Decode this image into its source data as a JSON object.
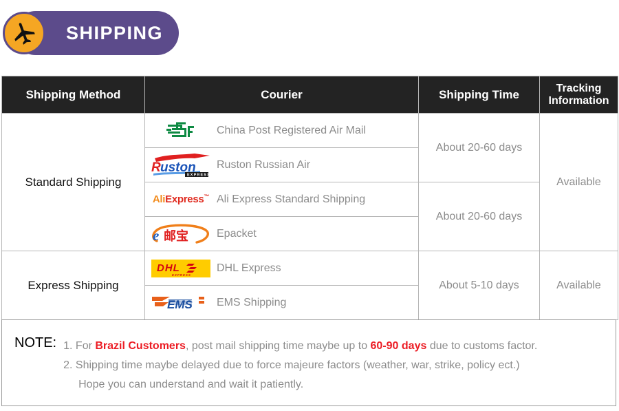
{
  "banner": {
    "title": "SHIPPING",
    "icon": "airplane-icon",
    "pill_color": "#5C4B8B",
    "badge_color": "#F5A623"
  },
  "table": {
    "headers": {
      "method": "Shipping Method",
      "courier": "Courier",
      "time": "Shipping Time",
      "tracking": "Tracking Information",
      "tracking_line1": "Tracking",
      "tracking_line2": "Information"
    },
    "groups": [
      {
        "method": "Standard Shipping",
        "tracking": "Available",
        "times": [
          {
            "label": "About 20-60 days",
            "rows": 2
          },
          {
            "label": "About 20-60 days",
            "rows": 2
          }
        ],
        "couriers": [
          {
            "logo": "china-post-logo",
            "name": "China Post Registered Air Mail"
          },
          {
            "logo": "ruston-logo",
            "name": "Ruston Russian Air"
          },
          {
            "logo": "aliexpress-logo",
            "name": "Ali Express Standard Shipping"
          },
          {
            "logo": "epacket-logo",
            "name": "Epacket"
          }
        ]
      },
      {
        "method": "Express Shipping",
        "tracking": "Available",
        "times": [
          {
            "label": "About 5-10 days",
            "rows": 2
          }
        ],
        "couriers": [
          {
            "logo": "dhl-logo",
            "name": "DHL Express"
          },
          {
            "logo": "ems-logo",
            "name": "EMS Shipping"
          }
        ]
      }
    ]
  },
  "logos": {
    "ali_part1": "Ali",
    "ali_part2": "Express",
    "ali_tm": "™",
    "ruston_r": "R",
    "ruston_rest": "uston",
    "ruston_sub": "EXPRESS",
    "dhl_text": "DHL",
    "dhl_sub": "EXPRESS",
    "ems_text": "EMS",
    "epacket_e": "e",
    "epacket_cn": "邮宝"
  },
  "note": {
    "title": "NOTE:",
    "line1_a": "1. For ",
    "line1_red1": "Brazil Customers",
    "line1_b": ", post mail shipping time maybe up to ",
    "line1_red2": "60-90 days",
    "line1_c": " due to customs factor.",
    "line2": "2. Shipping time maybe delayed due to force majeure factors (weather, war, strike, policy ect.)",
    "line3": "Hope you can understand and wait it patiently."
  }
}
